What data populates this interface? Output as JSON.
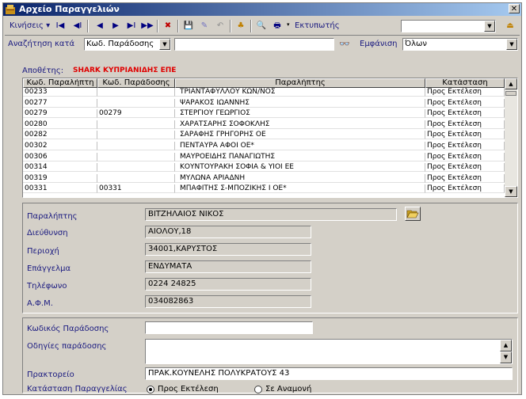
{
  "window": {
    "title": "Αρχείο Παραγγελιών",
    "close_label": "✕"
  },
  "toolbar": {
    "moves_label": "Κινήσεις",
    "moves_arrow": "▾",
    "printer_label": "Εκτυπωτής",
    "printer_value": "",
    "buttons": {
      "first": "I◀",
      "prev_page": "◀I",
      "prev": "◀",
      "next": "▶",
      "next_page": "▶I",
      "last": "▶▶",
      "delete": "✖",
      "save": "💾",
      "edit": "✎",
      "undo": "↶",
      "tree": "♣",
      "preview": "🔍",
      "print": "🖶",
      "exit": "⏏"
    }
  },
  "search": {
    "label": "Αναζήτηση κατά",
    "field_value": "Κωδ. Παράδοσης",
    "text_value": "",
    "find_icon_glyph": "👓",
    "display_label": "Εμφάνιση",
    "display_value": "Όλων"
  },
  "supplier": {
    "label": "Αποθέτης:",
    "value": "SHARK ΚΥΠΡΙΑΝΙΔΗΣ ΕΠΕ"
  },
  "grid": {
    "headers": [
      "Κωδ. Παραλήπτη",
      "Κωδ. Παράδοσης",
      "Παραλήπτης",
      "Κατάσταση"
    ],
    "rows": [
      [
        "00233",
        "",
        "ΤΡΙΑΝΤΑΦΥΛΛΟΥ ΚΩΝ/ΝΟΣ",
        "Προς Εκτέλεση"
      ],
      [
        "00277",
        "",
        "ΨΑΡΑΚΟΣ ΙΩΑΝΝΗΣ",
        "Προς Εκτέλεση"
      ],
      [
        "00279",
        "00279",
        "ΣΤΕΡΓΙΟΥ ΓΕΩΡΓΙΟΣ",
        "Προς Εκτέλεση"
      ],
      [
        "00280",
        "",
        "ΧΑΡΑΤΣΑΡΗΣ ΣΟΦΟΚΛΗΣ",
        "Προς Εκτέλεση"
      ],
      [
        "00282",
        "",
        "ΣΑΡΑΦΗΣ ΓΡΗΓΟΡΗΣ ΟΕ",
        "Προς Εκτέλεση"
      ],
      [
        "00302",
        "",
        "ΠΕΝΤΑΥΡΑ ΑΦΟΙ ΟΕ*",
        "Προς Εκτέλεση"
      ],
      [
        "00306",
        "",
        "ΜΑΥΡΟΕΙΔΗΣ ΠΑΝΑΓΙΩΤΗΣ",
        "Προς Εκτέλεση"
      ],
      [
        "00314",
        "",
        "ΚΟΥΝΤΟΥΡΑΚΗ ΣΟΦΙΑ & ΥΙΟΙ ΕΕ",
        "Προς Εκτέλεση"
      ],
      [
        "00319",
        "",
        "ΜΥΛΩΝΑ ΑΡΙΑΔΝΗ",
        "Προς Εκτέλεση"
      ],
      [
        "00331",
        "00331",
        "ΜΠΑΦΙΤΗΣ Σ-ΜΠΟΖΙΚΗΣ Ι ΟΕ*",
        "Προς Εκτέλεση"
      ]
    ]
  },
  "details": {
    "recipient": {
      "label": "Παραλήπτης",
      "value": "ΒΙΤΖΗΛΑΙΟΣ ΝΙΚΟΣ"
    },
    "address": {
      "label": "Διεύθυνση",
      "value": "ΑΙΟΛΟΥ,18"
    },
    "area": {
      "label": "Περιοχή",
      "value": "34001,ΚΑΡΥΣΤΟΣ"
    },
    "profession": {
      "label": "Επάγγελμα",
      "value": "ΕΝΔΥΜΑΤΑ"
    },
    "phone": {
      "label": "Τηλέφωνο",
      "value": "0224 24825"
    },
    "afm": {
      "label": "Α.Φ.Μ.",
      "value": "034082863"
    }
  },
  "delivery": {
    "code": {
      "label": "Κωδικός Παράδοσης",
      "value": ""
    },
    "instructions": {
      "label": "Οδηγίες παράδοσης",
      "value": ""
    },
    "agency": {
      "label": "Πρακτορείο",
      "value": "ΠΡΑΚ.ΚΟΥΝΕΛΗΣ ΠΟΛΥΚΡΑΤΟΥΣ 43"
    },
    "status": {
      "label": "Κατάσταση Παραγγελίας",
      "option1": "Προς Εκτέλεση",
      "option2": "Σε Αναμονή",
      "selected": "Προς Εκτέλεση"
    }
  },
  "colors": {
    "title_start": "#0a246a",
    "title_end": "#a6caf0",
    "supplier_value": "#e00000",
    "label_blue": "#1a1a80",
    "window_bg": "#d4d0c8"
  }
}
